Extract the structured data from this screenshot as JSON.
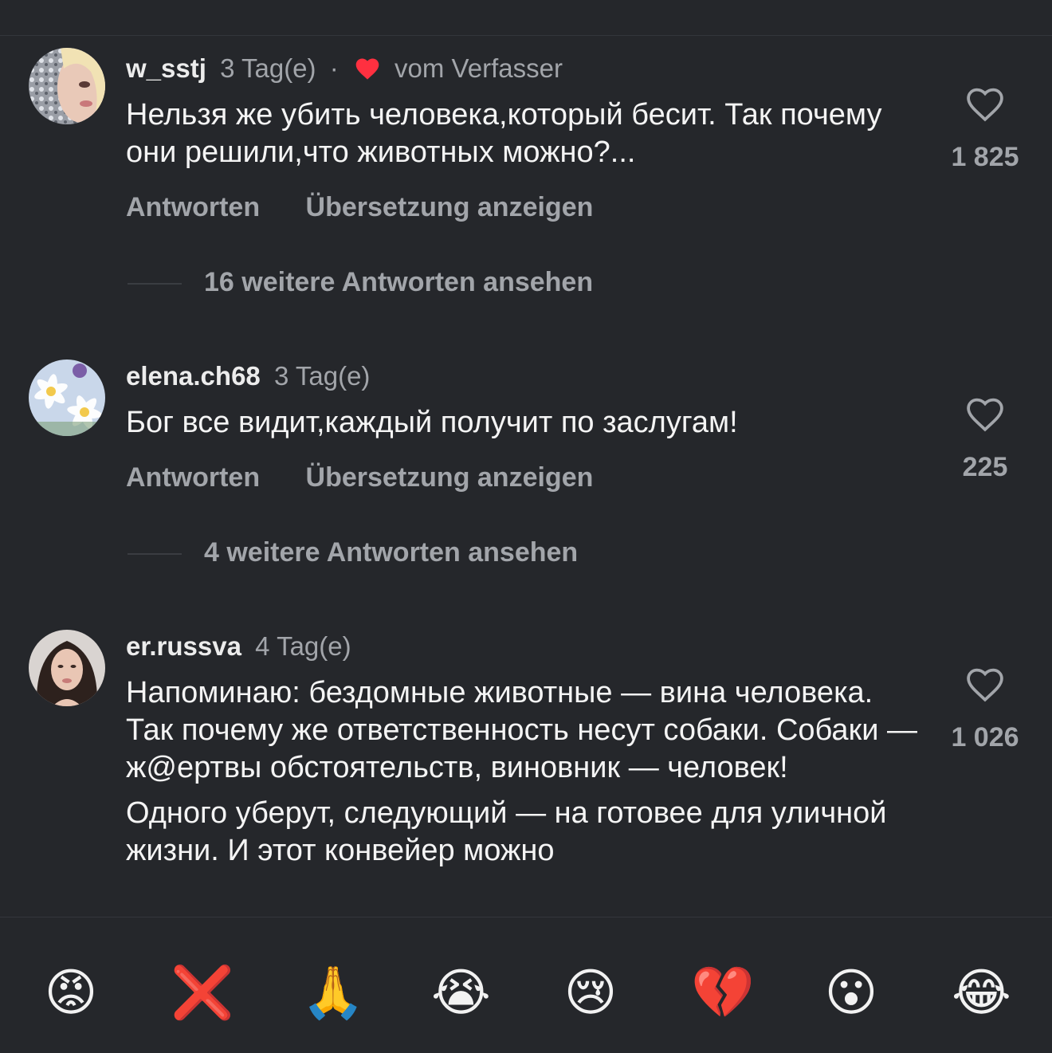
{
  "comments": [
    {
      "username": "w_sstj",
      "time": "3 Tag(e)",
      "separator": "·",
      "author_liked_label": "vom Verfasser",
      "text": [
        "Нельзя же убить человека,который бесит. Так почему они решили,что животных можно?..."
      ],
      "like_count": "1 825",
      "reply_label": "Antworten",
      "translate_label": "Übersetzung anzeigen",
      "more_replies": "16 weitere Antworten ansehen"
    },
    {
      "username": "elena.ch68",
      "time": "3 Tag(e)",
      "text": [
        "Бог все видит,каждый получит по заслугам!"
      ],
      "like_count": "225",
      "reply_label": "Antworten",
      "translate_label": "Übersetzung anzeigen",
      "more_replies": "4 weitere Antworten ansehen"
    },
    {
      "username": "er.russva",
      "time": "4 Tag(e)",
      "text": [
        "Напоминаю: бездомные животные — вина человека. Так почему же ответственность несут собаки. Собаки — ж@ертвы обстоятельств, виновник — человек!",
        "Одного уберут, следующий — на готовее для уличной жизни. И этот конвейер можно"
      ],
      "like_count": "1 026"
    }
  ],
  "emoji_bar": [
    {
      "name": "angry-face",
      "glyph": "😡"
    },
    {
      "name": "cross-mark",
      "glyph": "❌"
    },
    {
      "name": "folded-hands",
      "glyph": "🙏"
    },
    {
      "name": "loudly-crying-face",
      "glyph": "😭"
    },
    {
      "name": "crying-face",
      "glyph": "😢"
    },
    {
      "name": "broken-heart",
      "glyph": "💔"
    },
    {
      "name": "astonished-face",
      "glyph": "😮"
    },
    {
      "name": "tears-of-joy-face",
      "glyph": "😂"
    }
  ],
  "colors": {
    "background": "#25272b",
    "secondary_text": "#a2a5aa",
    "author_heart": "#ff3040"
  },
  "icons": {
    "like": "heart-outline-icon",
    "author_like": "heart-filled-icon"
  }
}
